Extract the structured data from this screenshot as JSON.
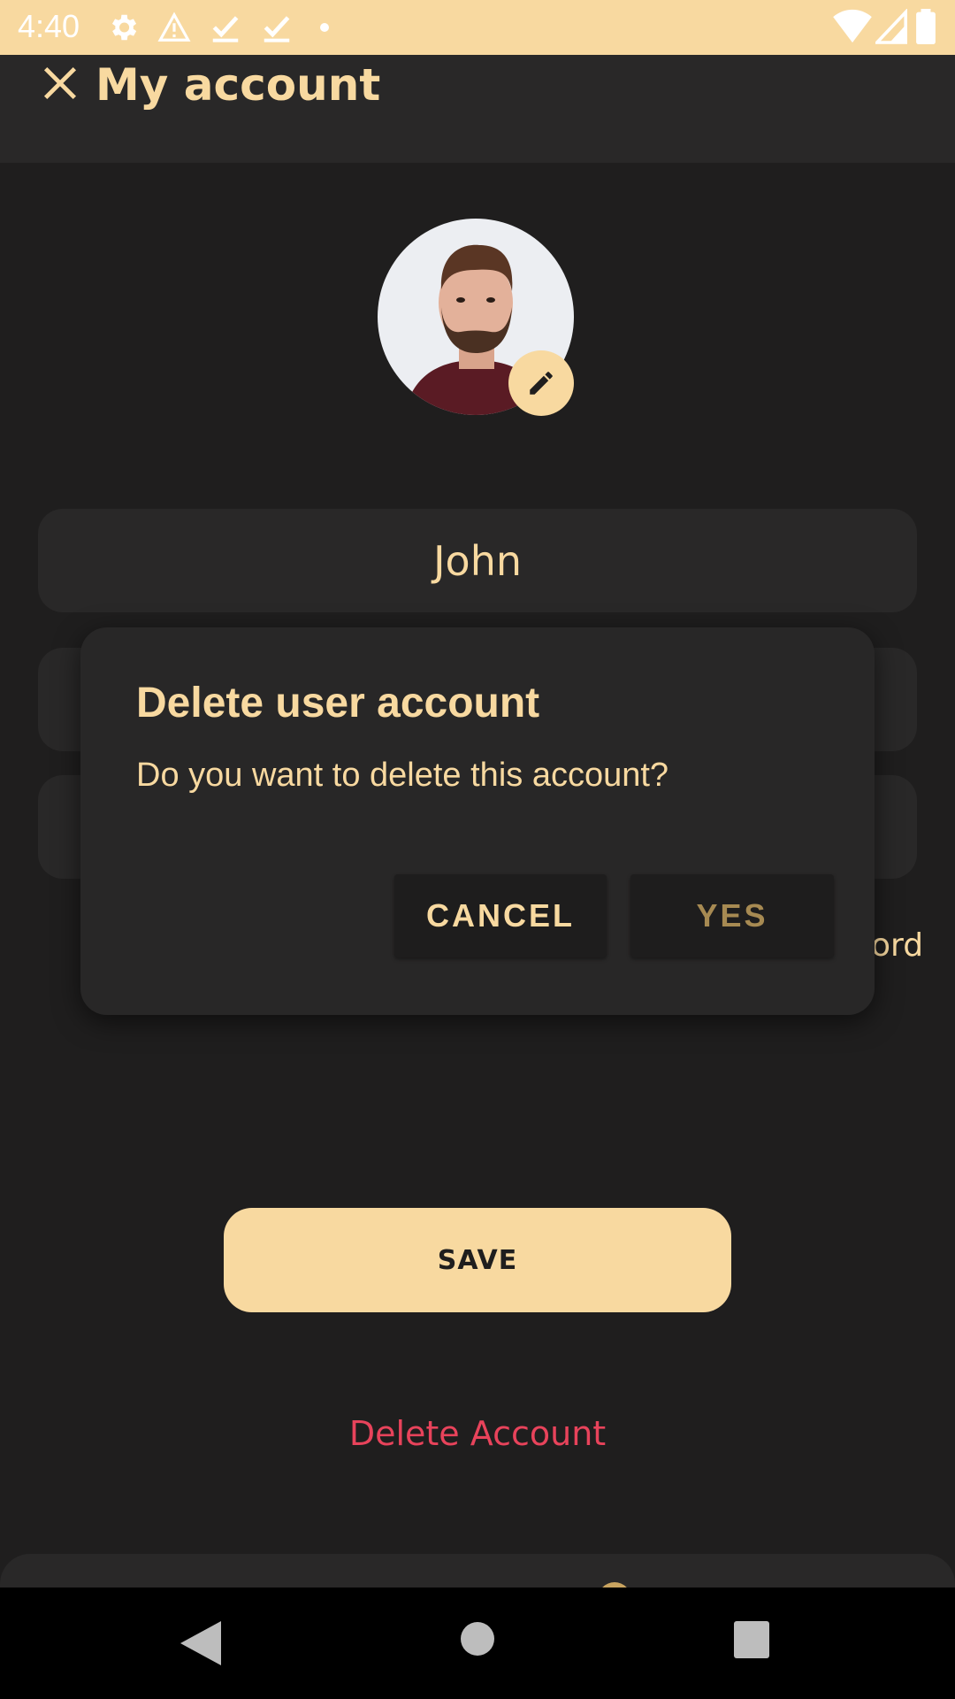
{
  "status_bar": {
    "time": "4:40",
    "icons": [
      "settings-icon",
      "warning-icon",
      "check-icon",
      "check-icon",
      "dot-icon",
      "wifi-icon",
      "signal-icon",
      "battery-icon"
    ]
  },
  "app_bar": {
    "title": "My account",
    "close_icon": "close-icon"
  },
  "profile": {
    "edit_icon": "pencil-icon"
  },
  "fields": {
    "first_name": "John",
    "peek_text": "ord"
  },
  "actions": {
    "save_label": "SAVE",
    "delete_label": "Delete Account"
  },
  "dialog": {
    "title": "Delete user account",
    "message": "Do you want to delete this account?",
    "cancel_label": "CANCEL",
    "confirm_label": "YES"
  },
  "colors": {
    "accent": "#f8d9a0",
    "background": "#1f1e1e",
    "surface": "#292828",
    "danger": "#e8435b"
  }
}
